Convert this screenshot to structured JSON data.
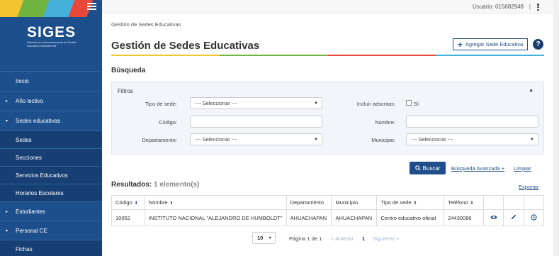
{
  "colors": {
    "sidebar": "#1c4f8c",
    "accent": "#1f4e8a",
    "stripes": [
      "#f2c430",
      "#6fb43f",
      "#45b0d9",
      "#e8473a"
    ]
  },
  "sidebar": {
    "logo_title": "SIGES",
    "logo_subtitle": "Sistema de Información para la Gestión Educativa Salvadoreña",
    "items": [
      {
        "label": "Inicio",
        "caret": ""
      },
      {
        "label": "Año lectivo",
        "caret": "▸"
      },
      {
        "label": "Sedes educativas",
        "caret": "▾"
      },
      {
        "label": "Sedes",
        "caret": ""
      },
      {
        "label": "Secciones",
        "caret": ""
      },
      {
        "label": "Servicios Educativos",
        "caret": ""
      },
      {
        "label": "Horarios Escolares",
        "caret": ""
      },
      {
        "label": "Estudiantes",
        "caret": "▸"
      },
      {
        "label": "Personal CE",
        "caret": "▾"
      },
      {
        "label": "Fichas",
        "caret": ""
      }
    ]
  },
  "topbar": {
    "user": "Usuario: 015682948",
    "separator": "|"
  },
  "main": {
    "breadcrumb": "Gestión de Sedes Educativas",
    "title": "Gestión de Sedes Educativas",
    "add_button": "Agregar Sede Educativa",
    "help": "?",
    "search_title": "Búsqueda"
  },
  "filters": {
    "title": "Filtros",
    "tipo_label": "Tipo de sede:",
    "tipo_value": "--- Seleccionar ---",
    "adscritas_label": "Incluir adscritas:",
    "adscritas_option": "Sí",
    "codigo_label": "Código:",
    "codigo_value": "",
    "nombre_label": "Nombre:",
    "nombre_value": "",
    "departamento_label": "Departamento:",
    "departamento_value": "--- Seleccionar ---",
    "municipio_label": "Municipio:",
    "municipio_value": "--- Seleccionar ---"
  },
  "actions": {
    "search": "Buscar",
    "advanced": "Búsqueda Avanzada +",
    "clear": "Limpiar",
    "export": "Exportar"
  },
  "results": {
    "title": "Resultados:",
    "count": "1 elemento(s)",
    "columns": [
      "Código",
      "Nombre",
      "Departamento",
      "Municipio",
      "Tipo de sede",
      "Teléfono"
    ],
    "rows": [
      [
        "10052",
        "INSTITUTO NACIONAL \"ALEJANDRO DE HUMBOLDT\"",
        "AHUACHAPAN",
        "AHUACHAPAN",
        "Centro educativo oficial",
        "24430086"
      ]
    ]
  },
  "pager": {
    "page_size": "10",
    "info": "Página 1 de 1",
    "prev": "< Anterior",
    "current": "1",
    "next": "Siguiente >"
  }
}
